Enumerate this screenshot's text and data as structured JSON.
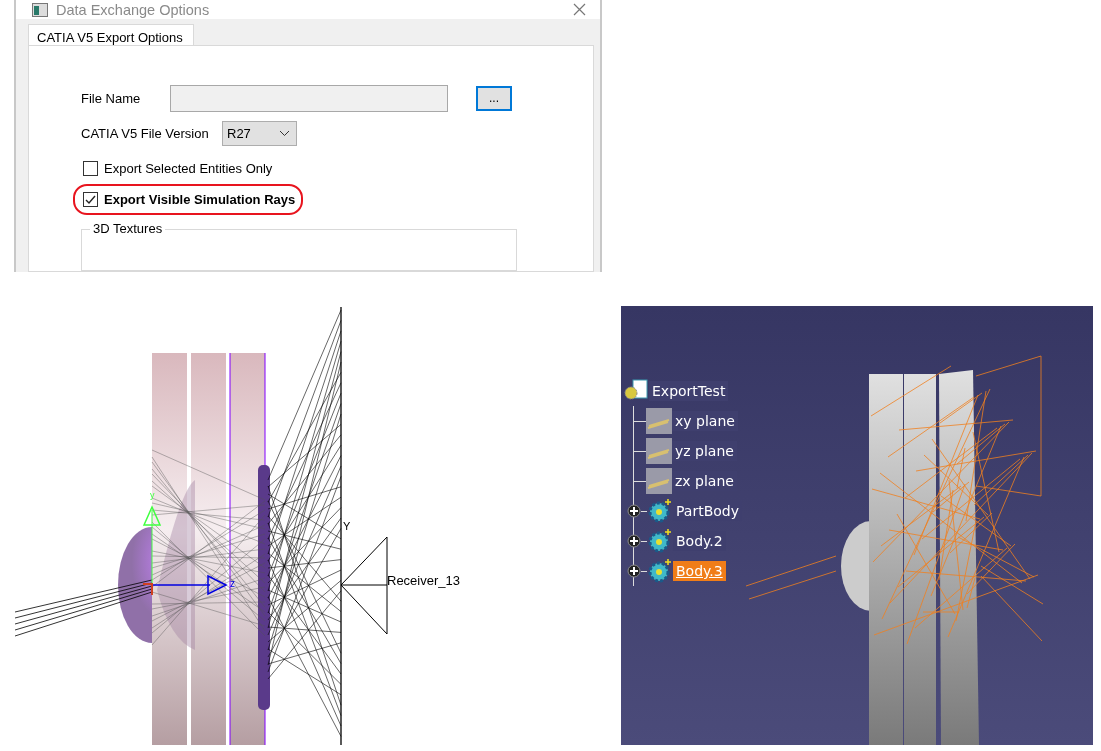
{
  "dialog": {
    "title": "Data Exchange Options",
    "tabs": [
      {
        "label": "CATIA V5 Export Options",
        "selected": true
      }
    ],
    "file_name": {
      "label": "File Name"
    },
    "browse_button": "...",
    "version": {
      "label": "CATIA V5 File Version",
      "value": "R27"
    },
    "options": [
      {
        "label": "Export Selected Entities Only",
        "checked": false,
        "highlighted": false
      },
      {
        "label": "Export Visible Simulation Rays",
        "checked": true,
        "highlighted": true
      }
    ],
    "group_title": "3D Textures"
  },
  "ray_view": {
    "axis_labels": [
      "y",
      "z"
    ],
    "receiver_axis": "Y",
    "receiver_name": "Receiver_13"
  },
  "catia_view": {
    "tree": {
      "label": "ExportTest",
      "children": [
        {
          "label": "xy plane",
          "kind": "plane",
          "selected": false
        },
        {
          "label": "yz plane",
          "kind": "plane",
          "selected": false
        },
        {
          "label": "zx plane",
          "kind": "plane",
          "selected": false
        },
        {
          "label": "PartBody",
          "kind": "body",
          "expanded": false,
          "selected": false
        },
        {
          "label": "Body.2",
          "kind": "body",
          "expanded": false,
          "selected": false
        },
        {
          "label": "Body.3",
          "kind": "body",
          "expanded": false,
          "selected": true
        }
      ]
    }
  }
}
